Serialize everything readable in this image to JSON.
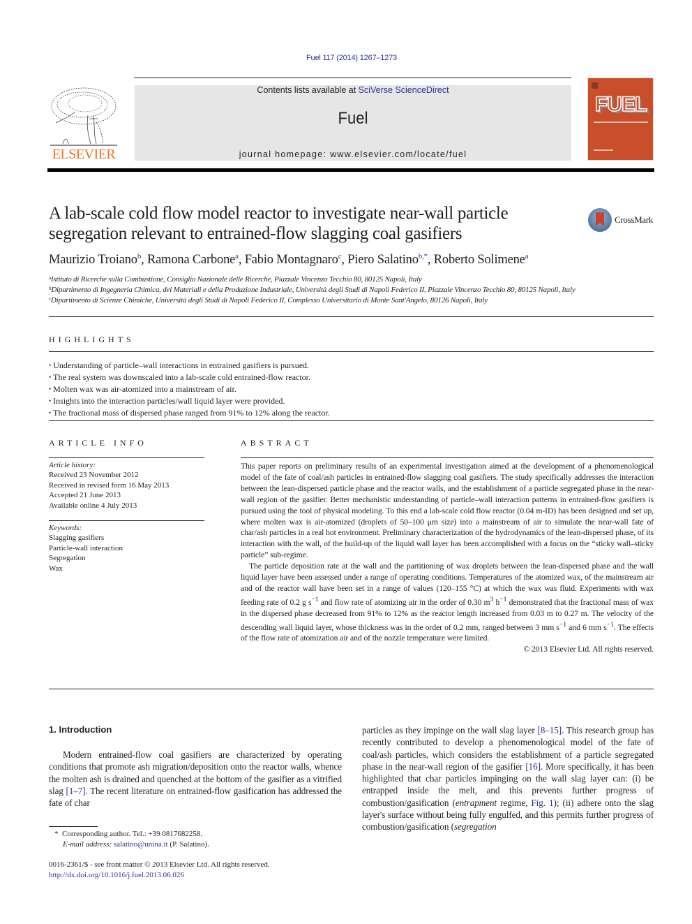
{
  "header": {
    "citation": "Fuel 117 (2014) 1267–1273",
    "publisher_logo_text": "ELSEVIER",
    "contents_prefix": "Contents lists available at ",
    "contents_link": "SciVerse ScienceDirect",
    "journal_name": "Fuel",
    "homepage_prefix": "journal homepage: ",
    "homepage_url": "www.elsevier.com/locate/fuel",
    "cover_title": "FUEL",
    "crossmark_label": "CrossMark",
    "colors": {
      "link": "#2e3192",
      "elsevier_orange": "#f37021",
      "cover_bg": "#c94f2a",
      "banner_bg": "#e6e6e6"
    }
  },
  "article": {
    "title_line1": "A lab-scale cold flow model reactor to investigate near-wall particle",
    "title_line2": "segregation relevant to entrained-flow slagging coal gasifiers",
    "authors": [
      {
        "name": "Maurizio Troiano",
        "sup": "b",
        "sep": ", "
      },
      {
        "name": "Ramona Carbone",
        "sup": "a",
        "sep": ", "
      },
      {
        "name": "Fabio Montagnaro",
        "sup": "c",
        "sep": ", "
      },
      {
        "name": "Piero Salatino",
        "sup": "b,*",
        "sep": ", "
      },
      {
        "name": "Roberto Solimene",
        "sup": "a",
        "sep": ""
      }
    ],
    "affiliations": [
      {
        "sup": "a",
        "text": "Istituto di Ricerche sulla Combustione, Consiglio Nazionale delle Ricerche, Piazzale Vincenzo Tecchio 80, 80125 Napoli, Italy"
      },
      {
        "sup": "b",
        "text": "Dipartimento di Ingegneria Chimica, dei Materiali e della Produzione Industriale, Università degli Studi di Napoli Federico II, Piazzale Vincenzo Tecchio 80, 80125 Napoli, Italy"
      },
      {
        "sup": "c",
        "text": "Dipartimento di Scienze Chimiche, Università degli Studi di Napoli Federico II, Complesso Universitario di Monte Sant'Angelo, 80126 Napoli, Italy"
      }
    ]
  },
  "highlights": {
    "heading": "HIGHLIGHTS",
    "items": [
      "Understanding of particle–wall interactions in entrained gasifiers is pursued.",
      "The real system was downscaled into a lab-scale cold entrained-flow reactor.",
      "Molten wax was air-atomized into a mainstream of air.",
      "Insights into the interaction particles/wall liquid layer were provided.",
      "The fractional mass of dispersed phase ranged from 91% to 12% along the reactor."
    ]
  },
  "article_info": {
    "heading": "ARTICLE INFO",
    "history_label": "Article history:",
    "history": [
      "Received 23 November 2012",
      "Received in revised form 16 May 2013",
      "Accepted 21 June 2013",
      "Available online 4 July 2013"
    ],
    "keywords_label": "Keywords:",
    "keywords": [
      "Slagging gasifiers",
      "Particle-wall interaction",
      "Segregation",
      "Wax"
    ]
  },
  "abstract": {
    "heading": "ABSTRACT",
    "p1": "This paper reports on preliminary results of an experimental investigation aimed at the development of a phenomenological model of the fate of coal/ash particles in entrained-flow slagging coal gasifiers. The study specifically addresses the interaction between the lean-dispersed particle phase and the reactor walls, and the establishment of a particle segregated phase in the near-wall region of the gasifier. Better mechanistic understanding of particle–wall interaction patterns in entrained-flow gasifiers is pursued using the tool of physical modeling. To this end a lab-scale cold flow reactor (0.04 m-ID) has been designed and set up, where molten wax is air-atomized (droplets of 50–100 μm size) into a mainstream of air to simulate the near-wall fate of char/ash particles in a real hot environment. Preliminary characterization of the hydrodynamics of the lean-dispersed phase, of its interaction with the wall, of the build-up of the liquid wall layer has been accomplished with a focus on the “sticky wall–sticky particle” sub-regime.",
    "p2_a": "The particle deposition rate at the wall and the partitioning of wax droplets between the lean-dispersed phase and the wall liquid layer have been assessed under a range of operating conditions. Temperatures of the atomized wax, of the mainstream air and of the reactor wall have been set in a range of values (120–155 °C) at which the wax was fluid. Experiments with wax feeding rate of 0.2 g s",
    "p2_b": " and flow rate of atomizing air in the order of 0.30 m",
    "p2_c": " h",
    "p2_d": " demonstrated that the fractional mass of wax in the dispersed phase decreased from 91% to 12% as the reactor length increased from 0.03 m to 0.27 m. The velocity of the descending wall liquid layer, whose thickness was in the order of 0.2 mm, ranged between 3 mm s",
    "p2_e": " and 6 mm s",
    "p2_f": ". The effects of the flow rate of atomization air and of the nozzle temperature were limited.",
    "sup_neg1": "−1",
    "sup_3": "3",
    "copyright": "© 2013 Elsevier Ltd. All rights reserved."
  },
  "introduction": {
    "heading": "1. Introduction",
    "left_a": "Modern entrained-flow coal gasifiers are characterized by operating conditions that promote ash migration/deposition onto the reactor walls, whence the molten ash is drained and quenched at the bottom of the gasifier as a vitrified slag ",
    "ref_1_7": "[1–7]",
    "left_b": ". The recent literature on entrained-flow gasification has addressed the fate of char",
    "right_a": "particles as they impinge on the wall slag layer ",
    "ref_8_15": "[8–15]",
    "right_b": ". This research group has recently contributed to develop a phenomenological model of the fate of coal/ash particles, which considers the establishment of a particle segregated phase in the near-wall region of the gasifier ",
    "ref_16": "[16]",
    "right_c": ". More specifically, it has been highlighted that char particles impinging on the wall slag layer can: (i) be entrapped inside the melt, and this prevents further progress of combustion/gasification (",
    "right_italic1": "entrapment",
    "right_d": " regime, ",
    "fig_ref": "Fig. 1",
    "right_e": "); (ii) adhere onto the slag layer's surface without being fully engulfed, and this permits further progress of combustion/gasification (",
    "right_italic2": "segregation"
  },
  "footnotes": {
    "corresponding": "Corresponding author. Tel.: +39 0817682258.",
    "email_label": "E-mail address: ",
    "email": "salatino@unina.it",
    "email_suffix": " (P. Salatino).",
    "front_matter": "0016-2361/$ - see front matter © 2013 Elsevier Ltd. All rights reserved.",
    "doi": "http://dx.doi.org/10.1016/j.fuel.2013.06.026"
  }
}
